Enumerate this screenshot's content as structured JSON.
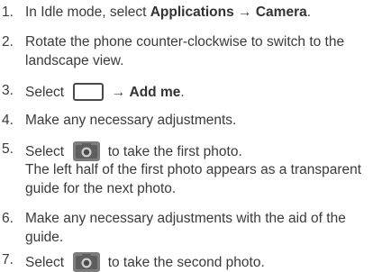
{
  "steps": [
    {
      "num": "1.",
      "pre": "In Idle mode, select ",
      "bold1": "Applications",
      "arrow": " → ",
      "bold2": "Camera",
      "post": "."
    },
    {
      "num": "2.",
      "line1": "Rotate the phone counter-clockwise to switch to the",
      "line2": "landscape view."
    },
    {
      "num": "3.",
      "pre": "Select ",
      "arrow": " → ",
      "bold": "Add me",
      "post": ".",
      "icon": "shooting-mode-icon"
    },
    {
      "num": "4.",
      "text": "Make any necessary adjustments."
    },
    {
      "num": "5.",
      "pre": "Select ",
      "post": " to take the first photo.",
      "icon": "camera-shutter-icon",
      "line2": "The left half of the first photo appears as a transparent",
      "line3": "guide for the next photo."
    },
    {
      "num": "6.",
      "line1": "Make any necessary adjustments with the aid of the",
      "line2": "guide."
    },
    {
      "num": "7.",
      "pre": "Select ",
      "post": " to take the second photo.",
      "icon": "camera-shutter-icon"
    }
  ]
}
